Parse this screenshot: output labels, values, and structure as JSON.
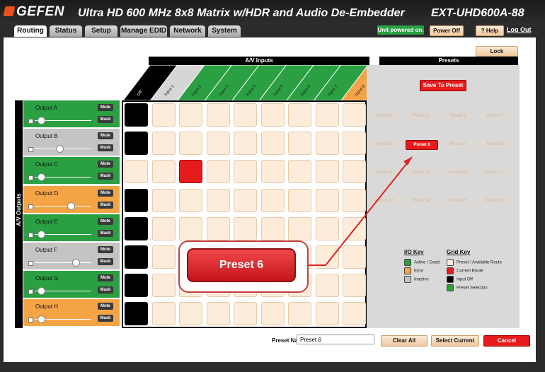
{
  "header": {
    "brand": "GEFEN",
    "title": "Ultra HD 600 MHz 8x8 Matrix w/HDR and Audio De-Embedder",
    "model": "EXT-UHD600A-88"
  },
  "tabs": [
    "Routing",
    "Status",
    "Setup",
    "Manage EDID",
    "Network",
    "System"
  ],
  "top_controls": {
    "unit_status": "Unit powered on.",
    "power_off": "Power Off",
    "help": "? Help",
    "logout": "Log Out"
  },
  "lock_label": "Lock",
  "inputs_header": "A/V Inputs",
  "outputs_label": "A/V Outputs",
  "columns": [
    "Off",
    "Input 1",
    "Input 2",
    "Input 3",
    "Input 4",
    "Input 5",
    "Input 6",
    "Input 7",
    "Input 8"
  ],
  "column_colors": [
    "#000000",
    "#d6d6d6",
    "#2aa043",
    "#2aa043",
    "#2aa043",
    "#2aa043",
    "#2aa043",
    "#2aa043",
    "#f5a445"
  ],
  "outputs": [
    {
      "name": "Output A",
      "color": "#2aa043",
      "volume": 0.05
    },
    {
      "name": "Output B",
      "color": "#c4c4c4",
      "volume": 0.4
    },
    {
      "name": "Output C",
      "color": "#2aa043",
      "volume": 0.05
    },
    {
      "name": "Output D",
      "color": "#f5a445",
      "volume": 0.6
    },
    {
      "name": "Output E",
      "color": "#2aa043",
      "volume": 0.05
    },
    {
      "name": "Output F",
      "color": "#c4c4c4",
      "volume": 0.7
    },
    {
      "name": "Output G",
      "color": "#2aa043",
      "volume": 0.05
    },
    {
      "name": "Output H",
      "color": "#f5a445",
      "volume": 0.05
    }
  ],
  "mute_label": "Mute",
  "mask_label": "Mask",
  "off_rows": [
    0,
    1,
    3,
    4,
    5,
    6,
    7
  ],
  "route": {
    "row": 2,
    "column": 2
  },
  "presets": {
    "header": "Presets",
    "save_label": "Save To Preset",
    "items": [
      "Preset 1",
      "Preset 2",
      "Preset 3",
      "Preset 4",
      "Preset 5",
      "Preset 6",
      "Preset 7",
      "Preset 8",
      "Preset 9",
      "Preset 10",
      "Preset 11",
      "Preset 12",
      "Preset 13",
      "Preset 14",
      "Preset 15",
      "Preset 16"
    ],
    "selected": "Preset 6"
  },
  "io_key": {
    "title": "I/O Key",
    "items": [
      {
        "label": "Active / Good",
        "color": "#2aa043"
      },
      {
        "label": "Error",
        "color": "#f5a445"
      },
      {
        "label": "Inactive",
        "color": "#c4c4c4"
      }
    ]
  },
  "grid_key": {
    "title": "Grid Key",
    "items": [
      {
        "label": "Preset / Available Route",
        "color": "#fdecda"
      },
      {
        "label": "Current Route",
        "color": "#e61b1b"
      },
      {
        "label": "Input Off",
        "color": "#000000"
      },
      {
        "label": "Preset Selection",
        "color": "#2aa043"
      }
    ]
  },
  "callout_label": "Preset 6",
  "footer": {
    "preset_name_label": "Preset Name",
    "preset_name_value": "Preset 6",
    "clear_all": "Clear All",
    "select_current": "Select Current",
    "cancel": "Cancel"
  }
}
